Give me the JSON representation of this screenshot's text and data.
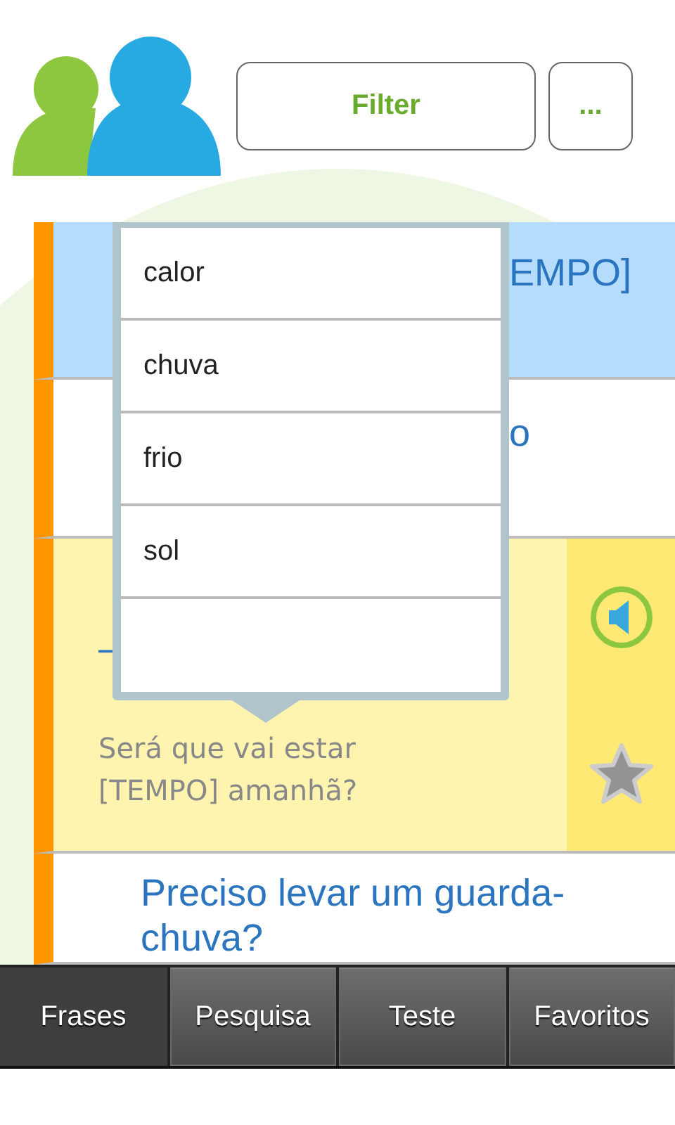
{
  "header": {
    "filter_button": "Filter",
    "more_button": "..."
  },
  "phrases": [
    {
      "text": "EMPO]",
      "selected": true,
      "expanded": false
    },
    {
      "text": "o",
      "selected": false,
      "expanded": false
    },
    {
      "text": "–",
      "selected": false,
      "expanded": true,
      "translation": "Será que vai estar [TEMPO] amanhã?"
    },
    {
      "text": "Preciso levar um guarda-chuva?",
      "selected": false,
      "expanded": false
    }
  ],
  "dropdown": {
    "items": [
      "calor",
      "chuva",
      "frio",
      "sol"
    ]
  },
  "tabs": [
    {
      "label": "Frases",
      "selected": true
    },
    {
      "label": "Pesquisa",
      "selected": false
    },
    {
      "label": "Teste",
      "selected": false
    },
    {
      "label": "Favoritos",
      "selected": false
    }
  ]
}
